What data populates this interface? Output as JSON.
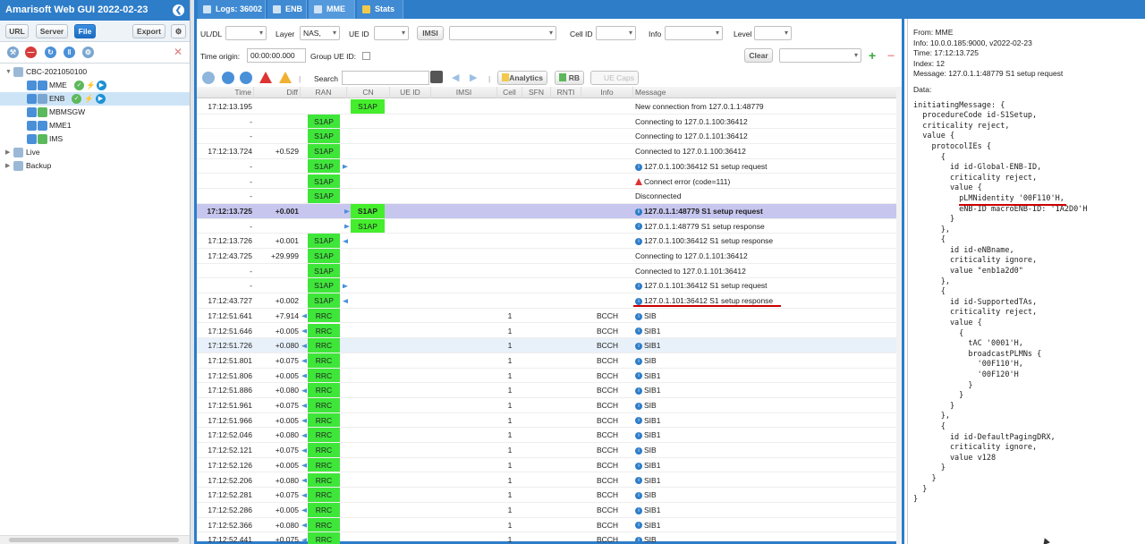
{
  "app": {
    "title": "Amarisoft Web GUI 2022-02-23"
  },
  "left": {
    "buttons": {
      "url": "URL",
      "server": "Server",
      "file": "File",
      "export": "Export"
    },
    "tree": {
      "root": "CBC-2021050100",
      "items": [
        {
          "label": "MME"
        },
        {
          "label": "ENB"
        },
        {
          "label": "MBMSGW"
        },
        {
          "label": "MME1"
        },
        {
          "label": "IMS"
        }
      ],
      "live": "Live",
      "backup": "Backup"
    }
  },
  "tabs": [
    {
      "label": "Logs: 36002"
    },
    {
      "label": "ENB"
    },
    {
      "label": "MME"
    },
    {
      "label": "Stats"
    }
  ],
  "filters": {
    "uldl_label": "UL/DL",
    "layer_label": "Layer",
    "layer_value": "NAS,",
    "ueid_label": "UE ID",
    "imsi_button": "IMSI",
    "cellid_label": "Cell ID",
    "info_label": "Info",
    "level_label": "Level",
    "time_origin_label": "Time origin:",
    "time_origin_value": "00:00:00.000",
    "group_ueid_label": "Group UE ID:",
    "clear_button": "Clear",
    "search_label": "Search",
    "analytics_button": "Analytics",
    "rb_button": "RB",
    "uecaps_button": "UE Caps"
  },
  "grid": {
    "headers": {
      "time": "Time",
      "diff": "Diff",
      "ran": "RAN",
      "cn": "CN",
      "ueid": "UE ID",
      "imsi": "IMSI",
      "cell": "Cell",
      "sfn": "SFN",
      "rnti": "RNTI",
      "info": "Info",
      "message": "Message"
    },
    "rows": [
      {
        "time": "17:12:13.195",
        "diff": "",
        "ran": "",
        "cn": "S1AP",
        "cell": "",
        "info": "",
        "msg": "New connection from 127.0.1.1:48779",
        "icon": ""
      },
      {
        "time": "-",
        "diff": "",
        "ran": "S1AP",
        "cn": "",
        "cell": "",
        "info": "",
        "msg": "Connecting to 127.0.1.100:36412",
        "icon": ""
      },
      {
        "time": "-",
        "diff": "",
        "ran": "S1AP",
        "cn": "",
        "cell": "",
        "info": "",
        "msg": "Connecting to 127.0.1.101:36412",
        "icon": ""
      },
      {
        "time": "17:12:13.724",
        "diff": "+0.529",
        "ran": "S1AP",
        "cn": "",
        "cell": "",
        "info": "",
        "msg": "Connected to 127.0.1.100:36412",
        "icon": ""
      },
      {
        "time": "-",
        "diff": "",
        "ran": "S1AP",
        "cn": "",
        "cell": "",
        "info": "",
        "msg": "127.0.1.100:36412 S1 setup request",
        "icon": "info"
      },
      {
        "time": "-",
        "diff": "",
        "ran": "S1AP",
        "cn": "",
        "cell": "",
        "info": "",
        "msg": "Connect error (code=111)",
        "icon": "warn"
      },
      {
        "time": "-",
        "diff": "",
        "ran": "S1AP",
        "cn": "",
        "cell": "",
        "info": "",
        "msg": "Disconnected",
        "icon": ""
      },
      {
        "time": "17:12:13.725",
        "diff": "+0.001",
        "ran": "",
        "cn": "S1AP",
        "cell": "",
        "info": "",
        "msg": "127.0.1.1:48779 S1 setup request",
        "icon": "info"
      },
      {
        "time": "-",
        "diff": "",
        "ran": "",
        "cn": "S1AP",
        "cell": "",
        "info": "",
        "msg": "127.0.1.1:48779 S1 setup response",
        "icon": "info"
      },
      {
        "time": "17:12:13.726",
        "diff": "+0.001",
        "ran": "S1AP",
        "cn": "",
        "cell": "",
        "info": "",
        "msg": "127.0.1.100:36412 S1 setup response",
        "icon": "info"
      },
      {
        "time": "17:12:43.725",
        "diff": "+29.999",
        "ran": "S1AP",
        "cn": "",
        "cell": "",
        "info": "",
        "msg": "Connecting to 127.0.1.101:36412",
        "icon": ""
      },
      {
        "time": "-",
        "diff": "",
        "ran": "S1AP",
        "cn": "",
        "cell": "",
        "info": "",
        "msg": "Connected to 127.0.1.101:36412",
        "icon": ""
      },
      {
        "time": "-",
        "diff": "",
        "ran": "S1AP",
        "cn": "",
        "cell": "",
        "info": "",
        "msg": "127.0.1.101:36412 S1 setup request",
        "icon": "info"
      },
      {
        "time": "17:12:43.727",
        "diff": "+0.002",
        "ran": "S1AP",
        "cn": "",
        "cell": "",
        "info": "",
        "msg": "127.0.1.101:36412 S1 setup response",
        "icon": "info"
      },
      {
        "time": "17:12:51.641",
        "diff": "+7.914",
        "ran": "RRC",
        "cn": "",
        "cell": "1",
        "info": "BCCH",
        "msg": "SIB",
        "icon": "info"
      },
      {
        "time": "17:12:51.646",
        "diff": "+0.005",
        "ran": "RRC",
        "cn": "",
        "cell": "1",
        "info": "BCCH",
        "msg": "SIB1",
        "icon": "info"
      },
      {
        "time": "17:12:51.726",
        "diff": "+0.080",
        "ran": "RRC",
        "cn": "",
        "cell": "1",
        "info": "BCCH",
        "msg": "SIB1",
        "icon": "info"
      },
      {
        "time": "17:12:51.801",
        "diff": "+0.075",
        "ran": "RRC",
        "cn": "",
        "cell": "1",
        "info": "BCCH",
        "msg": "SIB",
        "icon": "info"
      },
      {
        "time": "17:12:51.806",
        "diff": "+0.005",
        "ran": "RRC",
        "cn": "",
        "cell": "1",
        "info": "BCCH",
        "msg": "SIB1",
        "icon": "info"
      },
      {
        "time": "17:12:51.886",
        "diff": "+0.080",
        "ran": "RRC",
        "cn": "",
        "cell": "1",
        "info": "BCCH",
        "msg": "SIB1",
        "icon": "info"
      },
      {
        "time": "17:12:51.961",
        "diff": "+0.075",
        "ran": "RRC",
        "cn": "",
        "cell": "1",
        "info": "BCCH",
        "msg": "SIB",
        "icon": "info"
      },
      {
        "time": "17:12:51.966",
        "diff": "+0.005",
        "ran": "RRC",
        "cn": "",
        "cell": "1",
        "info": "BCCH",
        "msg": "SIB1",
        "icon": "info"
      },
      {
        "time": "17:12:52.046",
        "diff": "+0.080",
        "ran": "RRC",
        "cn": "",
        "cell": "1",
        "info": "BCCH",
        "msg": "SIB1",
        "icon": "info"
      },
      {
        "time": "17:12:52.121",
        "diff": "+0.075",
        "ran": "RRC",
        "cn": "",
        "cell": "1",
        "info": "BCCH",
        "msg": "SIB",
        "icon": "info"
      },
      {
        "time": "17:12:52.126",
        "diff": "+0.005",
        "ran": "RRC",
        "cn": "",
        "cell": "1",
        "info": "BCCH",
        "msg": "SIB1",
        "icon": "info"
      },
      {
        "time": "17:12:52.206",
        "diff": "+0.080",
        "ran": "RRC",
        "cn": "",
        "cell": "1",
        "info": "BCCH",
        "msg": "SIB1",
        "icon": "info"
      },
      {
        "time": "17:12:52.281",
        "diff": "+0.075",
        "ran": "RRC",
        "cn": "",
        "cell": "1",
        "info": "BCCH",
        "msg": "SIB",
        "icon": "info"
      },
      {
        "time": "17:12:52.286",
        "diff": "+0.005",
        "ran": "RRC",
        "cn": "",
        "cell": "1",
        "info": "BCCH",
        "msg": "SIB1",
        "icon": "info"
      },
      {
        "time": "17:12:52.366",
        "diff": "+0.080",
        "ran": "RRC",
        "cn": "",
        "cell": "1",
        "info": "BCCH",
        "msg": "SIB1",
        "icon": "info"
      },
      {
        "time": "17:12:52.441",
        "diff": "+0.075",
        "ran": "RRC",
        "cn": "",
        "cell": "1",
        "info": "BCCH",
        "msg": "SIB",
        "icon": "info"
      }
    ]
  },
  "detail": {
    "header_lines": [
      "From: MME",
      "Info: 10.0.0.185:9000, v2022-02-23",
      "Time: 17:12:13.725",
      "Index: 12",
      "Message: 127.0.1.1:48779 S1 setup request"
    ],
    "data_label": "Data:",
    "code_lines": [
      "initiatingMessage: {",
      "  procedureCode id-S1Setup,",
      "  criticality reject,",
      "  value {",
      "    protocolIEs {",
      "      {",
      "        id id-Global-ENB-ID,",
      "        criticality reject,",
      "        value {",
      "          pLMNidentity '00F110'H,",
      "          eNB-ID macroENB-ID: '1A2D0'H",
      "        }",
      "      },",
      "      {",
      "        id id-eNBname,",
      "        criticality ignore,",
      "        value \"enb1a2d0\"",
      "      },",
      "      {",
      "        id id-SupportedTAs,",
      "        criticality reject,",
      "        value {",
      "          {",
      "            tAC '0001'H,",
      "            broadcastPLMNs {",
      "              '00F110'H,",
      "              '00F120'H",
      "            }",
      "          }",
      "        }",
      "      },",
      "      {",
      "        id id-DefaultPagingDRX,",
      "        criticality ignore,",
      "        value v128",
      "      }",
      "    }",
      "  }",
      "}"
    ]
  }
}
